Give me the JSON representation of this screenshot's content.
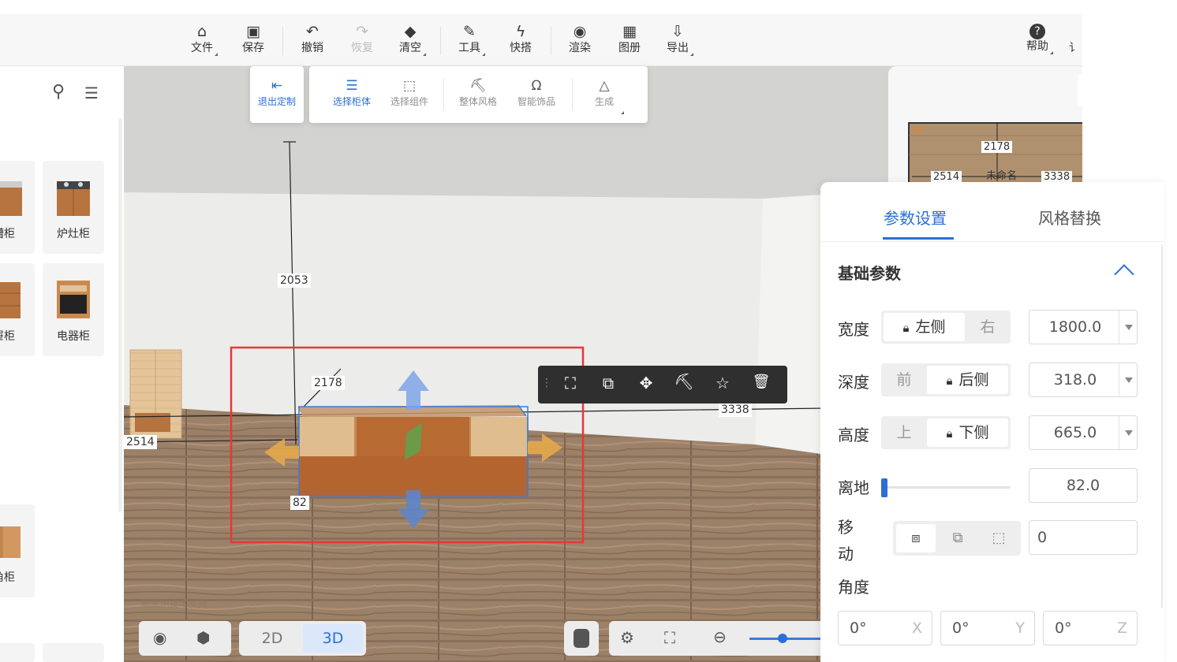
{
  "toolbar": {
    "items": [
      {
        "label": "文件",
        "icon": "house-file-icon",
        "glyph": "⌂"
      },
      {
        "label": "保存",
        "icon": "save-icon",
        "glyph": "▣"
      },
      {
        "label": "撤销",
        "icon": "undo-icon",
        "glyph": "↶"
      },
      {
        "label": "恢复",
        "icon": "redo-icon",
        "glyph": "↷"
      },
      {
        "label": "清空",
        "icon": "eraser-icon",
        "glyph": "◆"
      },
      {
        "label": "工具",
        "icon": "wrench-icon",
        "glyph": "✎"
      },
      {
        "label": "快搭",
        "icon": "lightning-icon",
        "glyph": "ϟ"
      },
      {
        "label": "渲染",
        "icon": "camera-icon",
        "glyph": "◉"
      },
      {
        "label": "图册",
        "icon": "picture-icon",
        "glyph": "▦"
      },
      {
        "label": "导出",
        "icon": "export-icon",
        "glyph": "⇩"
      }
    ],
    "help_label": "帮助",
    "help_glyph": "?",
    "cut_label": "讠"
  },
  "custom_toolbar": {
    "exit": {
      "label": "退出定制",
      "glyph": "⇤"
    },
    "items": [
      {
        "label": "选择柜体",
        "glyph": "☰"
      },
      {
        "label": "选择组件",
        "glyph": "⬚"
      },
      {
        "label": "整体风格",
        "glyph": "⛏"
      },
      {
        "label": "智能饰品",
        "glyph": "Ω"
      },
      {
        "label": "生成",
        "glyph": "△"
      }
    ]
  },
  "catalog": {
    "items": [
      {
        "label": "槽柜"
      },
      {
        "label": "炉灶柜"
      },
      {
        "label": "屉柜"
      },
      {
        "label": "电器柜"
      },
      {
        "label": "角柜"
      }
    ]
  },
  "viewport": {
    "dimensions": {
      "height_line": "2053",
      "width_top": "2178",
      "width_right": "3338",
      "width_left": "2514",
      "floor_height": "82"
    },
    "watermark": "酷家乐技术支持"
  },
  "selection_toolbar": {
    "icons": [
      "select-frame-icon",
      "copy-icon",
      "move-icon",
      "style-brush-icon",
      "star-icon",
      "trash-icon"
    ],
    "glyphs": [
      "⛶",
      "⧉",
      "✥",
      "⛏",
      "☆",
      "🗑"
    ]
  },
  "minimap": {
    "labels": {
      "top": "2178",
      "left": "2514",
      "right": "3338",
      "name": "未命名"
    }
  },
  "view_bar": {
    "mode_2d": "2D",
    "mode_3d": "3D",
    "active_mode": "3D"
  },
  "properties": {
    "tabs": [
      "参数设置",
      "风格替换"
    ],
    "active_tab": "参数设置",
    "section_title": "基础参数",
    "width": {
      "label": "宽度",
      "opt_a": "左侧",
      "opt_b": "右",
      "locked": "左侧",
      "value": "1800.0"
    },
    "depth": {
      "label": "深度",
      "opt_a": "前",
      "opt_b": "后侧",
      "locked": "后侧",
      "value": "318.0"
    },
    "height": {
      "label": "高度",
      "opt_a": "上",
      "opt_b": "下侧",
      "locked": "下侧",
      "value": "665.0"
    },
    "floor": {
      "label": "离地",
      "value": "82.0",
      "slider_fraction": 0.0
    },
    "move": {
      "label_line1": "移",
      "label_line2": "动",
      "value": "0"
    },
    "angle": {
      "label": "角度",
      "x": "0°",
      "y": "0°",
      "z": "0°",
      "ax_x": "X",
      "ax_y": "Y",
      "ax_z": "Z"
    }
  },
  "colors": {
    "accent": "#2c6fd6",
    "selection_red": "#e53935",
    "wood": "#b98256"
  }
}
